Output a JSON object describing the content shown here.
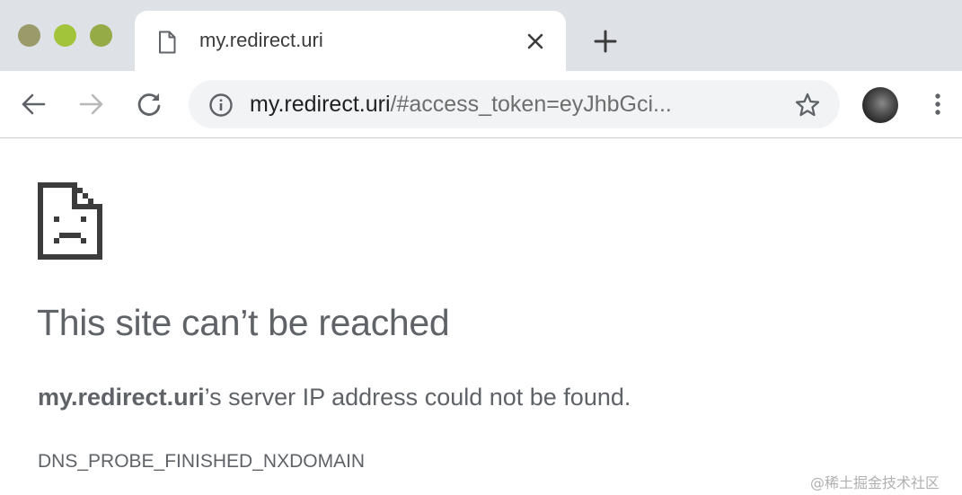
{
  "window": {
    "traffic_lights": [
      "close",
      "minimize",
      "zoom"
    ]
  },
  "tab": {
    "title": "my.redirect.uri",
    "icon": "page-icon",
    "close_icon": "close-icon"
  },
  "toolbar": {
    "back_icon": "back-arrow-icon",
    "forward_icon": "forward-arrow-icon",
    "reload_icon": "reload-icon",
    "new_tab_icon": "plus-icon",
    "url_host": "my.redirect.uri",
    "url_rest": "/#access_token=eyJhbGci...",
    "info_icon": "info-icon",
    "bookmark_icon": "star-icon",
    "menu_icon": "more-vert-icon"
  },
  "error_page": {
    "heading": "This site can’t be reached",
    "host": "my.redirect.uri",
    "message_rest": "’s server IP address could not be found.",
    "error_code": "DNS_PROBE_FINISHED_NXDOMAIN"
  },
  "watermark": "@稀土掘金技术社区",
  "colors": {
    "tabstrip_bg": "#dee1e6",
    "omnibox_bg": "#f1f3f4",
    "text_gray": "#5f6368"
  }
}
